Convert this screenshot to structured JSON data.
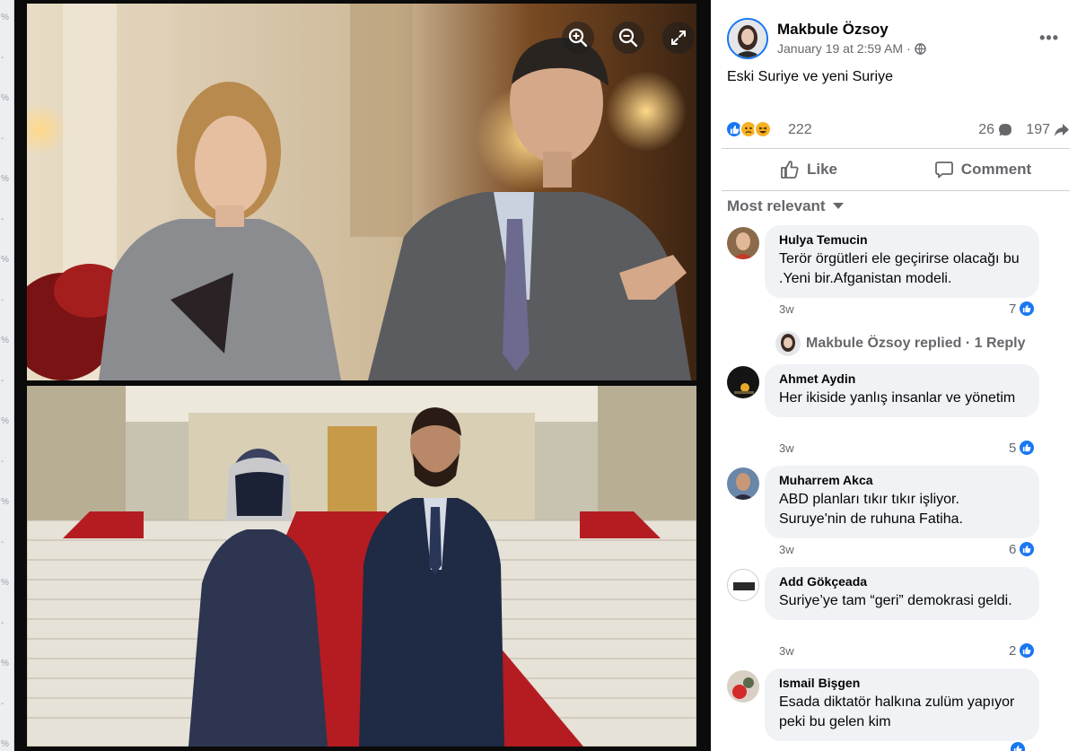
{
  "post": {
    "author": "Makbule Özsoy",
    "timestamp": "January 19 at 2:59 AM",
    "privacy_separator": "·",
    "text": "Eski Suriye ve yeni Suriye",
    "reactions_count": "222",
    "comments_count": "26",
    "shares_count": "197",
    "reaction_types": [
      "like",
      "sad",
      "haha"
    ],
    "more_label": "•••"
  },
  "actions": {
    "like_label": "Like",
    "comment_label": "Comment"
  },
  "comments_sort_label": "Most relevant",
  "comments": [
    {
      "name": "Hulya Temucin",
      "text": "Terör örgütleri ele geçirirse olacağı bu .Yeni bir.Afganistan modeli.",
      "time": "3w",
      "likes": "7"
    },
    {
      "name": "Ahmet Aydin",
      "text": "Her ikiside yanlış insanlar ve yönetim",
      "time": "3w",
      "likes": "5"
    },
    {
      "name": "Muharrem Akca",
      "text": "ABD planları tıkır tıkır işliyor. Suruye'nin de ruhuna Fatiha.",
      "time": "3w",
      "likes": "6"
    },
    {
      "name": "Add Gökçeada",
      "text": "Suriye’ye tam “geri” demokrasi geldi.",
      "time": "3w",
      "likes": "2"
    },
    {
      "name": "Ismail Bişgen",
      "text": "Esada diktatör halkına zulüm yapıyor peki bu gelen kim",
      "time": "",
      "likes": ""
    }
  ],
  "replies_link": "Makbule Özsoy replied · 1 Reply",
  "viewer": {
    "zoom_in_icon": "zoom-in-icon",
    "zoom_out_icon": "zoom-out-icon",
    "fullscreen_icon": "fullscreen-icon"
  },
  "gutter_marks": [
    "%",
    "-",
    "%",
    "-",
    "%",
    "-",
    "%",
    "-",
    "%",
    "-",
    "%",
    "-",
    "%",
    "-",
    "%",
    "-",
    "%",
    "-",
    "%"
  ],
  "colors": {
    "accent": "#1877f2",
    "secondary_text": "#65676b",
    "bubble_bg": "#f0f2f5"
  }
}
